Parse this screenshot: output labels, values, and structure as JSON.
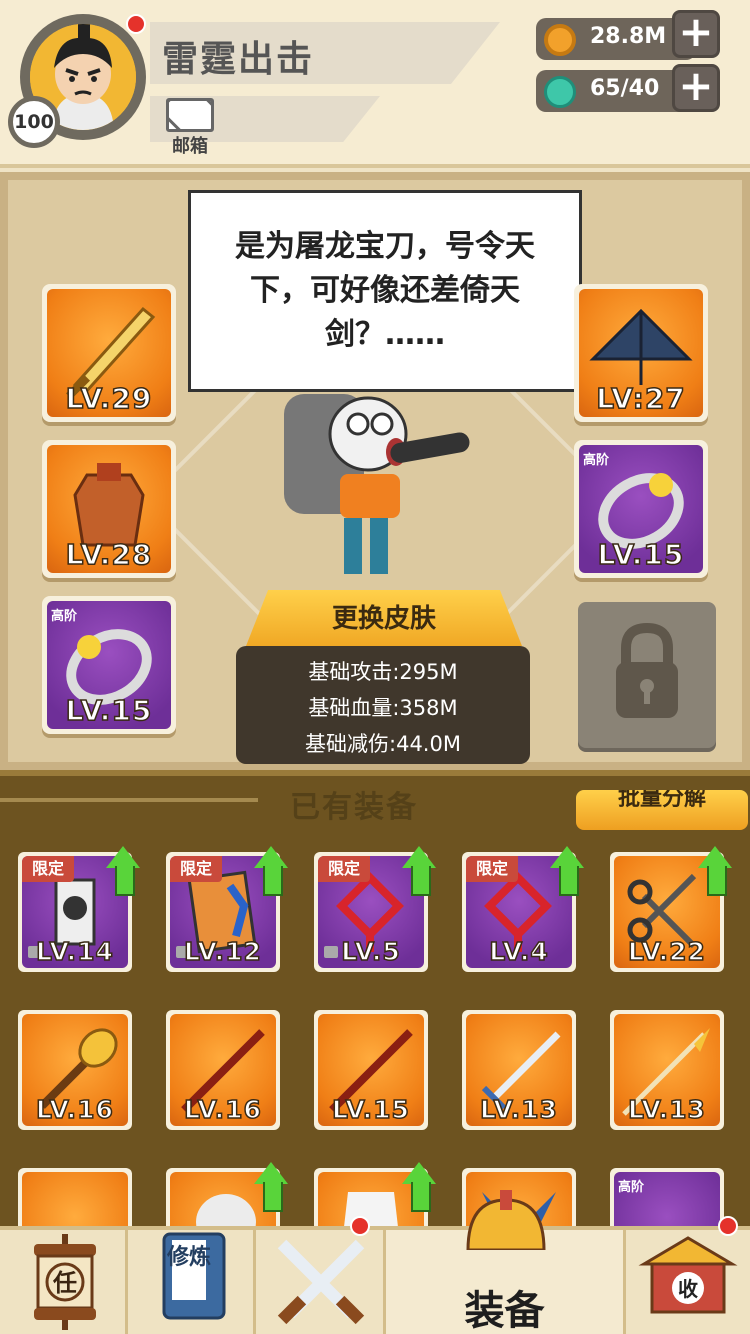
{
  "header": {
    "player_name": "雷霆出击",
    "level": "100",
    "mail_label": "邮箱",
    "gold": "28.8M",
    "gems": "65/40",
    "gold_color": "#f2a12b",
    "gem_color": "#3ec7a9"
  },
  "speech": {
    "text": "是为屠龙宝刀，号令天下，可好像还差倚天剑？……"
  },
  "equipped": {
    "left": [
      {
        "level": "LV.29",
        "icon": "golden-sword-icon",
        "rarity": "orange"
      },
      {
        "level": "LV.28",
        "icon": "armor-icon",
        "rarity": "orange"
      },
      {
        "level": "LV.15",
        "icon": "ring-icon",
        "rarity": "purple",
        "tag": "高阶"
      }
    ],
    "right": [
      {
        "level": "LV:27",
        "icon": "straw-hat-icon",
        "rarity": "orange"
      },
      {
        "level": "LV.15",
        "icon": "ring-icon",
        "rarity": "purple",
        "tag": "高阶"
      }
    ]
  },
  "skin_button": "更换皮肤",
  "stats": {
    "attack": "基础攻击:295M",
    "hp": "基础血量:358M",
    "defense": "基础减伤:44.0M"
  },
  "inventory": {
    "title": "已有装备",
    "batch_button": "批量分解",
    "rows": [
      [
        {
          "level": "LV.14",
          "tag": "限定",
          "rarity": "purple",
          "icon": "token-icon",
          "upgrade": true,
          "locked": true
        },
        {
          "level": "LV.12",
          "tag": "限定",
          "rarity": "purple",
          "icon": "book-icon",
          "upgrade": true,
          "locked": true
        },
        {
          "level": "LV.5",
          "tag": "限定",
          "rarity": "purple",
          "icon": "chinese-knot-icon",
          "upgrade": true,
          "locked": true
        },
        {
          "level": "LV.4",
          "tag": "限定",
          "rarity": "purple",
          "icon": "chinese-knot-icon",
          "upgrade": true,
          "locked": false
        },
        {
          "level": "LV.22",
          "tag": "",
          "rarity": "orange",
          "icon": "scissors-icon",
          "upgrade": true,
          "locked": false
        }
      ],
      [
        {
          "level": "LV.16",
          "rarity": "orange",
          "icon": "mace-icon"
        },
        {
          "level": "LV.16",
          "rarity": "orange",
          "icon": "staff-icon"
        },
        {
          "level": "LV.15",
          "rarity": "orange",
          "icon": "staff-icon"
        },
        {
          "level": "LV.13",
          "rarity": "orange",
          "icon": "sword-icon"
        },
        {
          "level": "LV.13",
          "rarity": "orange",
          "icon": "spear-icon"
        }
      ],
      [
        {
          "rarity": "orange",
          "icon": "hat-icon",
          "upgrade": false
        },
        {
          "rarity": "orange",
          "icon": "bird-icon",
          "upgrade": true
        },
        {
          "rarity": "orange",
          "icon": "robe-icon",
          "upgrade": true
        },
        {
          "rarity": "orange",
          "icon": "horns-icon",
          "upgrade": false
        },
        {
          "rarity": "purple",
          "icon": "shelter-icon",
          "tag": "高阶",
          "upgrade": false
        }
      ]
    ]
  },
  "nav": {
    "task_icon_label": "任",
    "cultivate_icon_label": "修炼",
    "equip_label": "装备",
    "collect_icon_label": "收"
  }
}
